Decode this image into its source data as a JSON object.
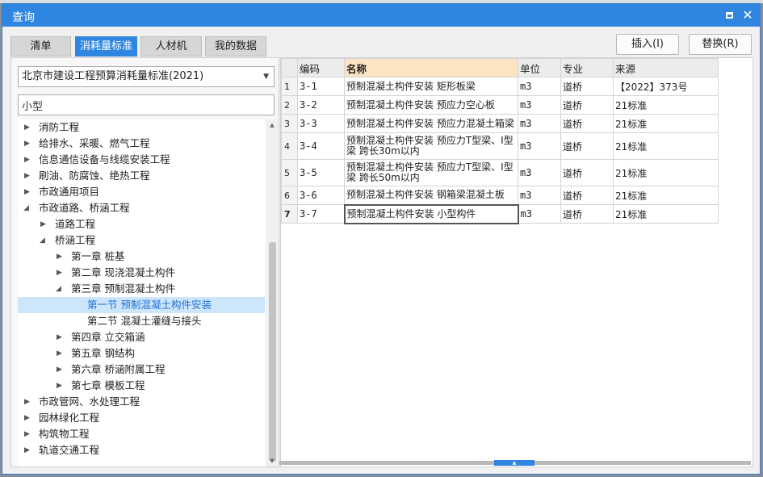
{
  "window": {
    "title": "查询",
    "accent_color": "#2e86e0"
  },
  "tabs": [
    {
      "label": "清单",
      "active": false
    },
    {
      "label": "消耗量标准",
      "active": true
    },
    {
      "label": "人材机",
      "active": false
    },
    {
      "label": "我的数据",
      "active": false
    }
  ],
  "actions": {
    "insert_label": "插入(I)",
    "replace_label": "替换(R)"
  },
  "standard_select": {
    "value": "北京市建设工程预算消耗量标准(2021)"
  },
  "search": {
    "value": "小型"
  },
  "tree": [
    {
      "label": "消防工程",
      "level": 0,
      "caret": "right"
    },
    {
      "label": "给排水、采暖、燃气工程",
      "level": 0,
      "caret": "right"
    },
    {
      "label": "信息通信设备与线缆安装工程",
      "level": 0,
      "caret": "right"
    },
    {
      "label": "刷油、防腐蚀、绝热工程",
      "level": 0,
      "caret": "right"
    },
    {
      "label": "市政通用项目",
      "level": 0,
      "caret": "right"
    },
    {
      "label": "市政道路、桥涵工程",
      "level": 0,
      "caret": "down"
    },
    {
      "label": "道路工程",
      "level": 1,
      "caret": "right"
    },
    {
      "label": "桥涵工程",
      "level": 1,
      "caret": "down"
    },
    {
      "label": "第一章 桩基",
      "level": 2,
      "caret": "right"
    },
    {
      "label": "第二章 现浇混凝土构件",
      "level": 2,
      "caret": "right"
    },
    {
      "label": "第三章 预制混凝土构件",
      "level": 2,
      "caret": "down"
    },
    {
      "label": "第一节 预制混凝土构件安装",
      "level": 3,
      "caret": "none",
      "selected": true
    },
    {
      "label": "第二节 混凝土灌缝与接头",
      "level": 3,
      "caret": "none"
    },
    {
      "label": "第四章 立交箱涵",
      "level": 2,
      "caret": "right"
    },
    {
      "label": "第五章 钢结构",
      "level": 2,
      "caret": "right"
    },
    {
      "label": "第六章 桥涵附属工程",
      "level": 2,
      "caret": "right"
    },
    {
      "label": "第七章 模板工程",
      "level": 2,
      "caret": "right"
    },
    {
      "label": "市政管网、水处理工程",
      "level": 0,
      "caret": "right"
    },
    {
      "label": "园林绿化工程",
      "level": 0,
      "caret": "right"
    },
    {
      "label": "构筑物工程",
      "level": 0,
      "caret": "right"
    },
    {
      "label": "轨道交通工程",
      "level": 0,
      "caret": "right"
    }
  ],
  "grid": {
    "columns": [
      "编码",
      "名称",
      "单位",
      "专业",
      "来源"
    ],
    "rows": [
      {
        "n": "1",
        "code": "3-1",
        "name": "预制混凝土构件安装 矩形板梁",
        "unit": "m3",
        "major": "道桥",
        "source": "【2022】373号"
      },
      {
        "n": "2",
        "code": "3-2",
        "name": "预制混凝土构件安装 预应力空心板",
        "unit": "m3",
        "major": "道桥",
        "source": "21标准"
      },
      {
        "n": "3",
        "code": "3-3",
        "name": "预制混凝土构件安装 预应力混凝土箱梁",
        "unit": "m3",
        "major": "道桥",
        "source": "21标准"
      },
      {
        "n": "4",
        "code": "3-4",
        "name": "预制混凝土构件安装 预应力T型梁、I型梁 跨长30m以内",
        "unit": "m3",
        "major": "道桥",
        "source": "21标准"
      },
      {
        "n": "5",
        "code": "3-5",
        "name": "预制混凝土构件安装 预应力T型梁、I型梁 跨长50m以内",
        "unit": "m3",
        "major": "道桥",
        "source": "21标准"
      },
      {
        "n": "6",
        "code": "3-6",
        "name": "预制混凝土构件安装 钢箱梁混凝土板",
        "unit": "m3",
        "major": "道桥",
        "source": "21标准"
      },
      {
        "n": "7",
        "code": "3-7",
        "name": "预制混凝土构件安装 小型构件",
        "unit": "m3",
        "major": "道桥",
        "source": "21标准",
        "current": true
      }
    ]
  }
}
